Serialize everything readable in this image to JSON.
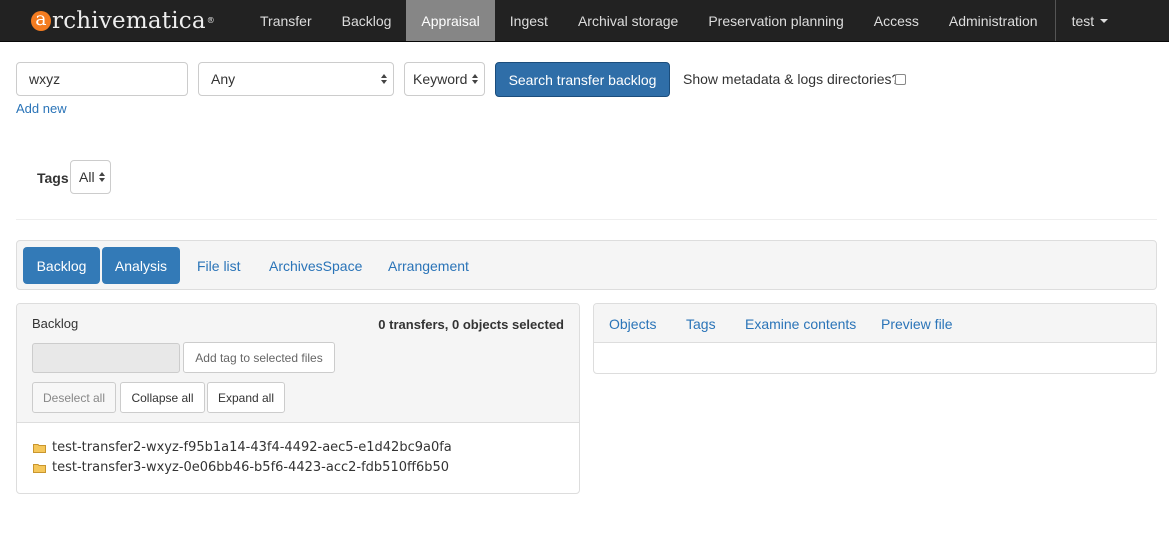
{
  "brand": {
    "name": "rchivematica",
    "initial": "a",
    "reg": "®"
  },
  "nav": {
    "items": [
      "Transfer",
      "Backlog",
      "Appraisal",
      "Ingest",
      "Archival storage",
      "Preservation planning",
      "Access",
      "Administration"
    ],
    "active": "Appraisal",
    "user": "test"
  },
  "search": {
    "query": "wxyz",
    "field_select": "Any",
    "type_select": "Keyword",
    "submit_label": "Search transfer backlog",
    "show_metadata_label": "Show metadata & logs directories?",
    "show_metadata_checked": false,
    "add_new_label": "Add new"
  },
  "tags_filter": {
    "label": "Tags",
    "value": "All"
  },
  "tabs": {
    "pills": [
      "Backlog",
      "Analysis"
    ],
    "links": [
      "File list",
      "ArchivesSpace",
      "Arrangement"
    ]
  },
  "backlog_panel": {
    "title": "Backlog",
    "selection_summary": "0 transfers, 0 objects selected",
    "tag_input_value": "",
    "add_tag_label": "Add tag to selected files",
    "deselect_all_label": "Deselect all",
    "collapse_all_label": "Collapse all",
    "expand_all_label": "Expand all",
    "items": [
      "test-transfer2-wxyz-f95b1a14-43f4-4492-aec5-e1d42bc9a0fa",
      "test-transfer3-wxyz-0e06bb46-b5f6-4423-acc2-fdb510ff6b50"
    ]
  },
  "analysis_panel": {
    "tabs": [
      "Objects",
      "Tags",
      "Examine contents",
      "Preview file"
    ]
  },
  "colors": {
    "navbar_bg": "#222222",
    "nav_active_bg": "#868686",
    "primary": "#337ab7",
    "link": "#2a74b8",
    "brand_accent": "#f47c20"
  }
}
